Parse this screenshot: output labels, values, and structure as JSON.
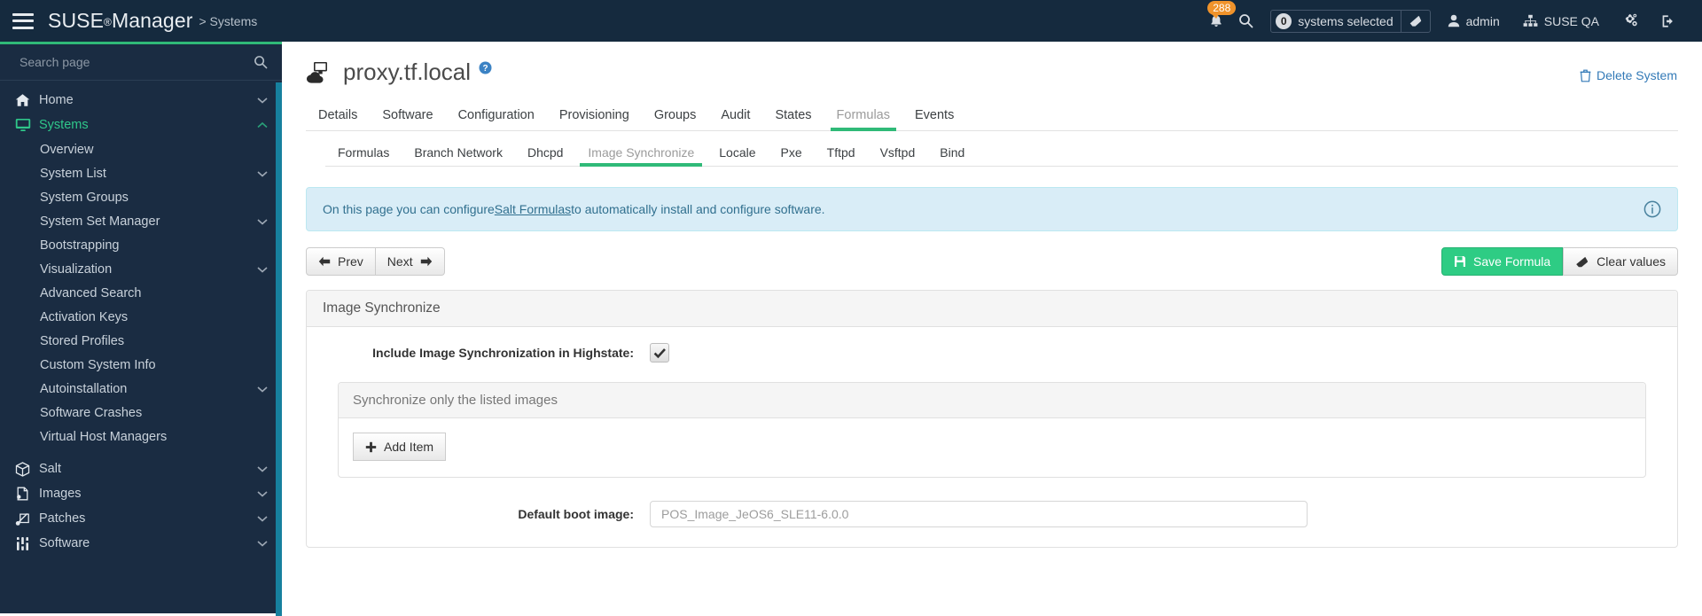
{
  "topnav": {
    "menu_icon": "hamburger-icon",
    "brand": "SUSE",
    "brand_reg": "®",
    "brand2": "Manager",
    "breadcrumb": "> Systems",
    "notifications_count": "288",
    "search_icon": "search-icon",
    "selected_count": "0",
    "selected_label": "systems selected",
    "eraser_icon": "eraser-icon",
    "user": "admin",
    "org": "SUSE QA",
    "gear_icon": "gear-icon",
    "logout_icon": "logout-icon"
  },
  "sidebar": {
    "search_placeholder": "Search page",
    "search_value": "",
    "items": [
      {
        "label": "Home",
        "icon": "home-icon",
        "chevron": "down",
        "active": false
      },
      {
        "label": "Systems",
        "icon": "monitor-icon",
        "chevron": "up",
        "active": true
      },
      {
        "label": "Salt",
        "icon": "cube-icon",
        "chevron": "down",
        "active": false
      },
      {
        "label": "Images",
        "icon": "images-icon",
        "chevron": "down",
        "active": false
      },
      {
        "label": "Patches",
        "icon": "bandage-icon",
        "chevron": "down",
        "active": false
      },
      {
        "label": "Software",
        "icon": "sliders-icon",
        "chevron": "down",
        "active": false
      }
    ],
    "sub_items": [
      {
        "label": "Overview",
        "chevron": ""
      },
      {
        "label": "System List",
        "chevron": "down"
      },
      {
        "label": "System Groups",
        "chevron": ""
      },
      {
        "label": "System Set Manager",
        "chevron": "down"
      },
      {
        "label": "Bootstrapping",
        "chevron": ""
      },
      {
        "label": "Visualization",
        "chevron": "down"
      },
      {
        "label": "Advanced Search",
        "chevron": ""
      },
      {
        "label": "Activation Keys",
        "chevron": ""
      },
      {
        "label": "Stored Profiles",
        "chevron": ""
      },
      {
        "label": "Custom System Info",
        "chevron": ""
      },
      {
        "label": "Autoinstallation",
        "chevron": "down"
      },
      {
        "label": "Software Crashes",
        "chevron": ""
      },
      {
        "label": "Virtual Host Managers",
        "chevron": ""
      }
    ]
  },
  "page": {
    "title": "proxy.tf.local",
    "title_icon": "salt-minion-icon",
    "help_icon": "help-circle-icon",
    "delete_label": "Delete System",
    "delete_icon": "trash-icon"
  },
  "tabs_primary": [
    {
      "label": "Details",
      "active": false
    },
    {
      "label": "Software",
      "active": false
    },
    {
      "label": "Configuration",
      "active": false
    },
    {
      "label": "Provisioning",
      "active": false
    },
    {
      "label": "Groups",
      "active": false
    },
    {
      "label": "Audit",
      "active": false
    },
    {
      "label": "States",
      "active": false
    },
    {
      "label": "Formulas",
      "active": true
    },
    {
      "label": "Events",
      "active": false
    }
  ],
  "tabs_secondary": [
    {
      "label": "Formulas",
      "active": false
    },
    {
      "label": "Branch Network",
      "active": false
    },
    {
      "label": "Dhcpd",
      "active": false
    },
    {
      "label": "Image Synchronize",
      "active": true
    },
    {
      "label": "Locale",
      "active": false
    },
    {
      "label": "Pxe",
      "active": false
    },
    {
      "label": "Tftpd",
      "active": false
    },
    {
      "label": "Vsftpd",
      "active": false
    },
    {
      "label": "Bind",
      "active": false
    }
  ],
  "alert": {
    "text_before": "On this page you can configure ",
    "link": "Salt Formulas",
    "text_after": " to automatically install and configure software.",
    "info_icon": "info-circle-icon"
  },
  "toolbar": {
    "prev_label": "Prev",
    "next_label": "Next",
    "prev_icon": "arrow-left-icon",
    "next_icon": "arrow-right-icon",
    "save_label": "Save Formula",
    "save_icon": "floppy-disk-icon",
    "clear_label": "Clear values",
    "clear_icon": "eraser-icon"
  },
  "form": {
    "panel_title": "Image Synchronize",
    "highstate_label": "Include Image Synchronization in Highstate:",
    "highstate_checked": true,
    "inner_panel_title": "Synchronize only the listed images",
    "add_item_label": "Add Item",
    "add_item_icon": "plus-icon",
    "boot_image_label": "Default boot image:",
    "boot_image_value": "",
    "boot_image_placeholder": "POS_Image_JeOS6_SLE11-6.0.0"
  },
  "colors": {
    "accent_green": "#30ba78",
    "sidebar_bg": "#1a2c42",
    "topnav_bg": "#152a3e",
    "badge_orange": "#f0932b",
    "link_blue": "#337ab7",
    "alert_bg": "#d9edf7",
    "scrollbar_blue": "#16809e"
  }
}
